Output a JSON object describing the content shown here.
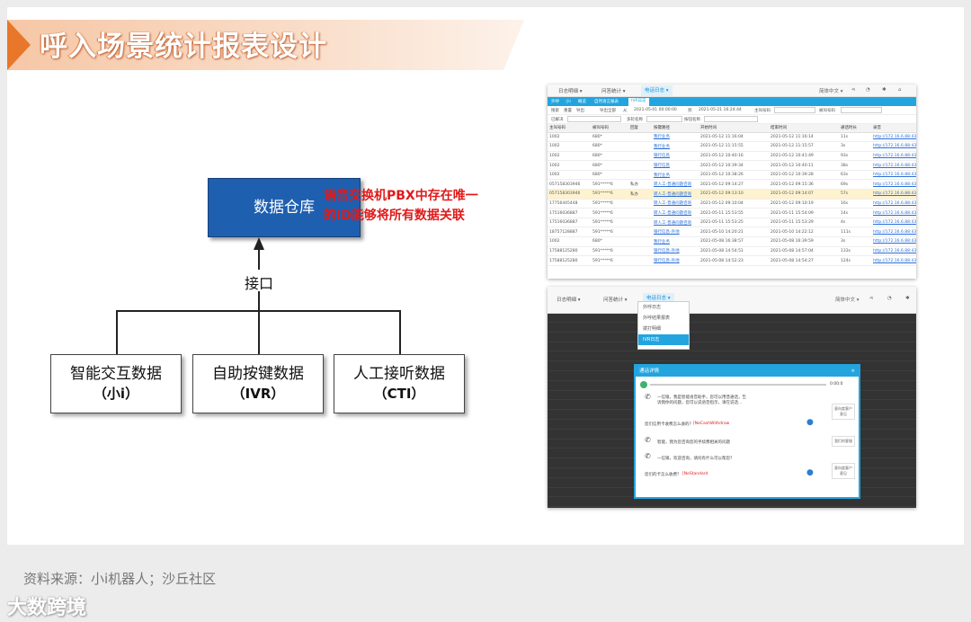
{
  "slide": {
    "title": "呼入场景统计报表设计",
    "source_text": "资料来源：小i机器人；沙丘社区",
    "watermark": "大数跨境"
  },
  "diagram": {
    "warehouse": "数据仓库",
    "interface_label": "接口",
    "note_line1": "语音交换机PBX中存在唯一",
    "note_line2": "的ID能够将所有数据关联",
    "sources": [
      {
        "name": "智能交互数据",
        "sub": "（小i）"
      },
      {
        "name": "自助按键数据",
        "sub": "（IVR）"
      },
      {
        "name": "人工接听数据",
        "sub": "（CTI）"
      }
    ]
  },
  "app": {
    "nav": [
      "日志明细 ▾",
      "问答统计 ▾",
      "电话日志 ▾"
    ],
    "nav_active": "电话日志 ▾",
    "lang": "简体中文 ▾",
    "tabs": [
      "外呼",
      "小i",
      "概览",
      "自然语言报表",
      "IVR日志"
    ],
    "tab_active": "IVR日志",
    "filter": {
      "btn_search": "搜索",
      "btn_reset": "重置",
      "btn_export": "导出",
      "btn_export_all": "导出全部",
      "from_label": "从",
      "from_value": "2021-05-01 00:00:00",
      "to_label": "到",
      "to_value": "2021-05-21 16:24:44",
      "caller_label": "主叫号码",
      "callee_label": "被叫号码",
      "line2_a": "已解决",
      "line2_b": "多轮名称",
      "line2_c": "按钮名称"
    },
    "columns": [
      "主叫号码",
      "被叫号码",
      "回复",
      "按键路径",
      "开始时间",
      "结束时间",
      "通话时长",
      "录音"
    ],
    "rows": [
      [
        "1002",
        "680*",
        "",
        "我行业务",
        "2021-05-12 11:16:04",
        "2021-05-12 11:16:14",
        "11s",
        "http://172.16.6.88:4355/v..."
      ],
      [
        "1002",
        "680*",
        "",
        "我行业务",
        "2021-05-12 11:15:55",
        "2021-05-12 11:15:57",
        "3s",
        "http://172.16.6.88:4355/v..."
      ],
      [
        "1002",
        "680*",
        "",
        "银行信息",
        "2021-05-12 10:40:16",
        "2021-05-12 10:41:49",
        "93s",
        "http://172.16.6.88:4355/v..."
      ],
      [
        "1002",
        "680*",
        "",
        "银行信息",
        "2021-05-12 10:39:34",
        "2021-05-12 10:40:11",
        "38s",
        "http://172.16.6.88:4355/v..."
      ],
      [
        "1002",
        "680*",
        "",
        "我行业务",
        "2021-05-12 10:38:26",
        "2021-05-12 10:39:28",
        "63s",
        "http://172.16.6.88:4355/v..."
      ],
      [
        "057158303946",
        "591*****6",
        "私办",
        "转人工-普通问题咨询",
        "2021-05-12 09:14:27",
        "2021-05-12 09:15:36",
        "69s",
        "http://172.16.6.88:4355/v..."
      ],
      [
        "057158303946",
        "591*****6",
        "私办",
        "转人工-普通问题咨询",
        "2021-05-12 09:13:10",
        "2021-05-12 09:14:07",
        "57s",
        "http://172.16.6.88:4355/v..."
      ],
      [
        "17756445448",
        "591*****6",
        "",
        "转人工-普通问题咨询",
        "2021-05-12 09:10:04",
        "2021-05-12 09:10:19",
        "16s",
        "http://172.16.6.88:4355/v..."
      ],
      [
        "17516036887",
        "591*****6",
        "",
        "转人工-普通问题咨询",
        "2021-05-11 15:53:55",
        "2021-05-11 15:54:09",
        "14s",
        "http://172.16.6.88:4355/v..."
      ],
      [
        "17516036887",
        "591*****6",
        "",
        "转人工-普通问题咨询",
        "2021-05-11 15:53:25",
        "2021-05-11 15:53:29",
        "4s",
        "http://172.16.6.88:4355/v..."
      ],
      [
        "18757128887",
        "591*****6",
        "",
        "银行信息-外地",
        "2021-05-10 14:20:21",
        "2021-05-10 14:22:12",
        "111s",
        "http://172.16.6.88:4355/v..."
      ],
      [
        "1002",
        "680*",
        "",
        "我行业务",
        "2021-05-08 16:38:57",
        "2021-05-08 16:39:59",
        "3s",
        "http://172.16.6.88:4355/v..."
      ],
      [
        "17588125280",
        "591*****6",
        "",
        "银行信息-外地",
        "2021-05-08 14:54:51",
        "2021-05-08 14:57:04",
        "133s",
        "http://172.16.6.88:4355/v..."
      ],
      [
        "17588125280",
        "591*****6",
        "",
        "银行信息-外地",
        "2021-05-08 14:52:23",
        "2021-05-08 14:54:27",
        "124s",
        "http://172.16.6.88:4355/v..."
      ]
    ],
    "highlight_row": 6,
    "dropdown": [
      "外呼日志",
      "外呼结果报表",
      "拨打明细",
      "IVR日志"
    ],
    "dropdown_active": 3,
    "dialog": {
      "title": "通话详情",
      "close": "×",
      "time": "0:00:0",
      "msg1": "一信银，我是智能语音助手，您可以用普通话，告诉我你的问题，您可以说语音指示，请在说话...",
      "user1": "您们信用卡收费怎么收的？",
      "user1_tag": "[NeCashWithdraw",
      "msg2": "智能，我为您咨询您的手续费相关的问题",
      "msg3": "一信银，欢迎咨询，请问有什么可以帮您？",
      "user2": "您们的卡怎么收费？",
      "user2_tag": "[NeStandard",
      "side1": "意向度客户意见",
      "side2": "我们的客服",
      "side3": "意向度客户意见"
    }
  }
}
